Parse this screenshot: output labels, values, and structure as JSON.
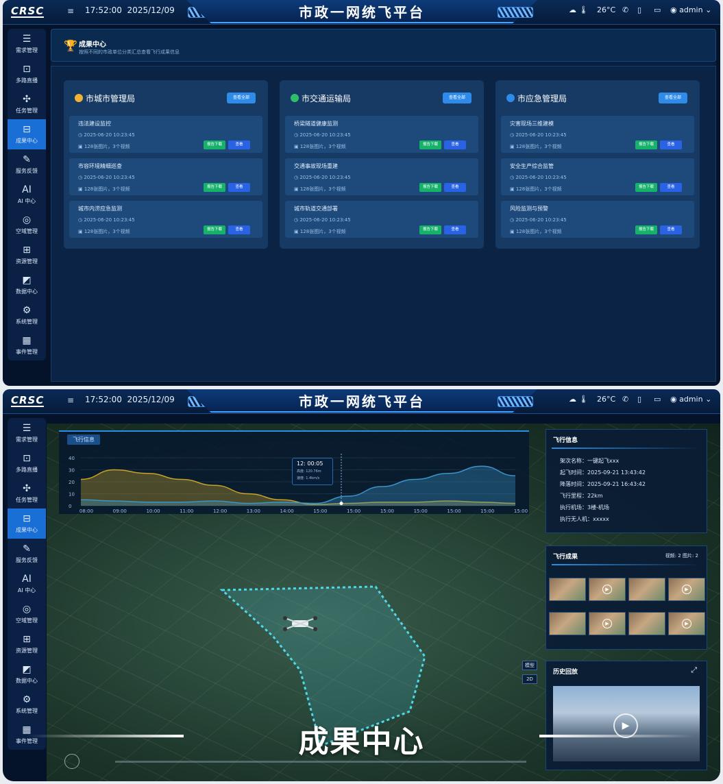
{
  "app": {
    "logo": "CRSC",
    "title": "市政一网统飞平台",
    "time": "17:52:00",
    "date": "2025/12/09",
    "temp": "26°C",
    "user": "admin"
  },
  "nav": [
    {
      "label": "需求管理",
      "icon": "☰"
    },
    {
      "label": "多路直播",
      "icon": "⊡"
    },
    {
      "label": "任务管理",
      "icon": "✣"
    },
    {
      "label": "成果中心",
      "icon": "⊟"
    },
    {
      "label": "服务反馈",
      "icon": "✎"
    },
    {
      "label": "AI 中心",
      "icon": "AI"
    },
    {
      "label": "空域管理",
      "icon": "◎"
    },
    {
      "label": "资源管理",
      "icon": "⊞"
    },
    {
      "label": "数据中心",
      "icon": "◩"
    },
    {
      "label": "系统管理",
      "icon": "⚙"
    },
    {
      "label": "事件管理",
      "icon": "▦"
    }
  ],
  "results": {
    "header_title": "成果中心",
    "header_sub": "按照不同的市政单位分类汇总查看飞行成果信息",
    "view_all": "查看全部",
    "download": "报告下载",
    "view": "查看",
    "cards": [
      {
        "title": "市城市管理局",
        "color": "#f2b233",
        "items": [
          {
            "name": "违法建设监控",
            "time": "2025-06-20 10:23:45",
            "media": "128张图片，3个视频"
          },
          {
            "name": "市容环境精细巡查",
            "time": "2025-06-20 10:23:45",
            "media": "128张图片，3个视频"
          },
          {
            "name": "城市内涝应急监测",
            "time": "2025-06-20 10:23:45",
            "media": "128张图片，3个视频"
          }
        ]
      },
      {
        "title": "市交通运输局",
        "color": "#2fbf6a",
        "items": [
          {
            "name": "桥梁隧道健康监测",
            "time": "2025-06-20 10:23:45",
            "media": "128张图片，3个视频"
          },
          {
            "name": "交通事故现场重建",
            "time": "2025-06-20 10:23:45",
            "media": "128张图片，3个视频"
          },
          {
            "name": "城市轨道交通部署",
            "time": "2025-06-20 10:23:45",
            "media": "128张图片，3个视频"
          }
        ]
      },
      {
        "title": "市应急管理局",
        "color": "#2e8bea",
        "items": [
          {
            "name": "灾害现场三维建模",
            "time": "2025-06-20 10:23:45",
            "media": "128张图片，3个视频"
          },
          {
            "name": "安全生产综合监管",
            "time": "2025-06-20 10:23:45",
            "media": "128张图片，3个视频"
          },
          {
            "name": "风险监测与预警",
            "time": "2025-06-20 10:23:45",
            "media": "128张图片，3个视频"
          }
        ]
      }
    ]
  },
  "flight": {
    "chart_tag": "飞行信息",
    "tooltip_time": "12: 00:05",
    "tooltip_alt": "高度: 120.76m",
    "tooltip_speed": "速度: 1.4km/s",
    "info_title": "飞行信息",
    "info": [
      {
        "k": "架次名称",
        "v": "一键起飞xxx"
      },
      {
        "k": "起飞时间",
        "v": "2025-09-21 13:43:42"
      },
      {
        "k": "降落时间",
        "v": "2025-09-21 16:43:42"
      },
      {
        "k": "飞行里程",
        "v": "22km"
      },
      {
        "k": "执行机场",
        "v": "3楼-机场"
      },
      {
        "k": "执行无人机",
        "v": "xxxxx"
      }
    ],
    "results_title": "飞行成果",
    "results_count": "视频: 2   图片: 2",
    "history_title": "历史回放",
    "btn_model": "模型",
    "btn_2d": "2D"
  },
  "chart_data": {
    "type": "area",
    "x": [
      "08:00",
      "09:00",
      "10:00",
      "11:00",
      "12:00",
      "13:00",
      "14:00",
      "15:00",
      "15:00",
      "15:00",
      "15:00",
      "15:00",
      "15:00",
      "15:00"
    ],
    "ylim": [
      0,
      40
    ],
    "yticks": [
      0,
      10,
      20,
      30,
      40
    ],
    "series": [
      {
        "values": [
          22,
          30,
          27,
          22,
          17,
          10,
          5,
          1,
          2,
          3,
          3,
          4,
          3,
          2
        ],
        "color": "#c9a227"
      },
      {
        "values": [
          5,
          4,
          3,
          3,
          4,
          2,
          3,
          2,
          8,
          16,
          22,
          27,
          33,
          25
        ],
        "color": "#3a95c9"
      }
    ]
  },
  "banner": {
    "text": "成果中心"
  }
}
